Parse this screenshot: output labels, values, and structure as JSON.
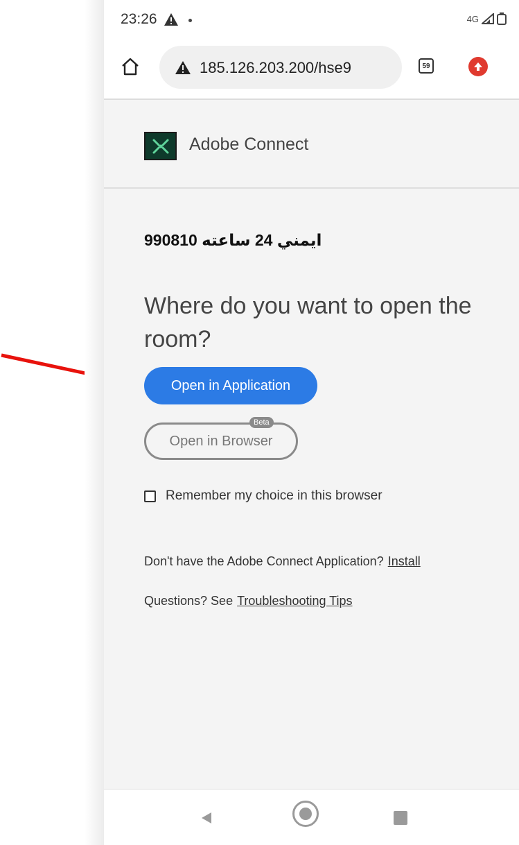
{
  "status_bar": {
    "time": "23:26",
    "network": "4G",
    "icons": [
      "warning-icon",
      "notification-dot",
      "signal-icon",
      "battery-icon"
    ]
  },
  "browser": {
    "url": "185.126.203.200/hse9",
    "tab_count": "59",
    "icons": [
      "home-icon",
      "insecure-warning-icon",
      "tabs-icon",
      "extension-icon"
    ]
  },
  "header": {
    "brand": "Adobe Connect",
    "logo_icon": "adobe-connect-logo"
  },
  "content": {
    "room_name": "ايمني 24 ساعته 990810",
    "question": "Where do you want to open the room?",
    "open_app_label": "Open in Application",
    "open_browser_label": "Open in Browser",
    "beta_label": "Beta",
    "remember_label": "Remember my choice in this browser",
    "install_prompt": "Don't have the Adobe Connect Application?",
    "install_link": "Install",
    "tips_prompt": "Questions? See",
    "tips_link": "Troubleshooting Tips"
  },
  "colors": {
    "primary_button": "#2c7be5",
    "annotation_arrow": "#e8120c",
    "logo_bg": "#0e3a2b"
  }
}
